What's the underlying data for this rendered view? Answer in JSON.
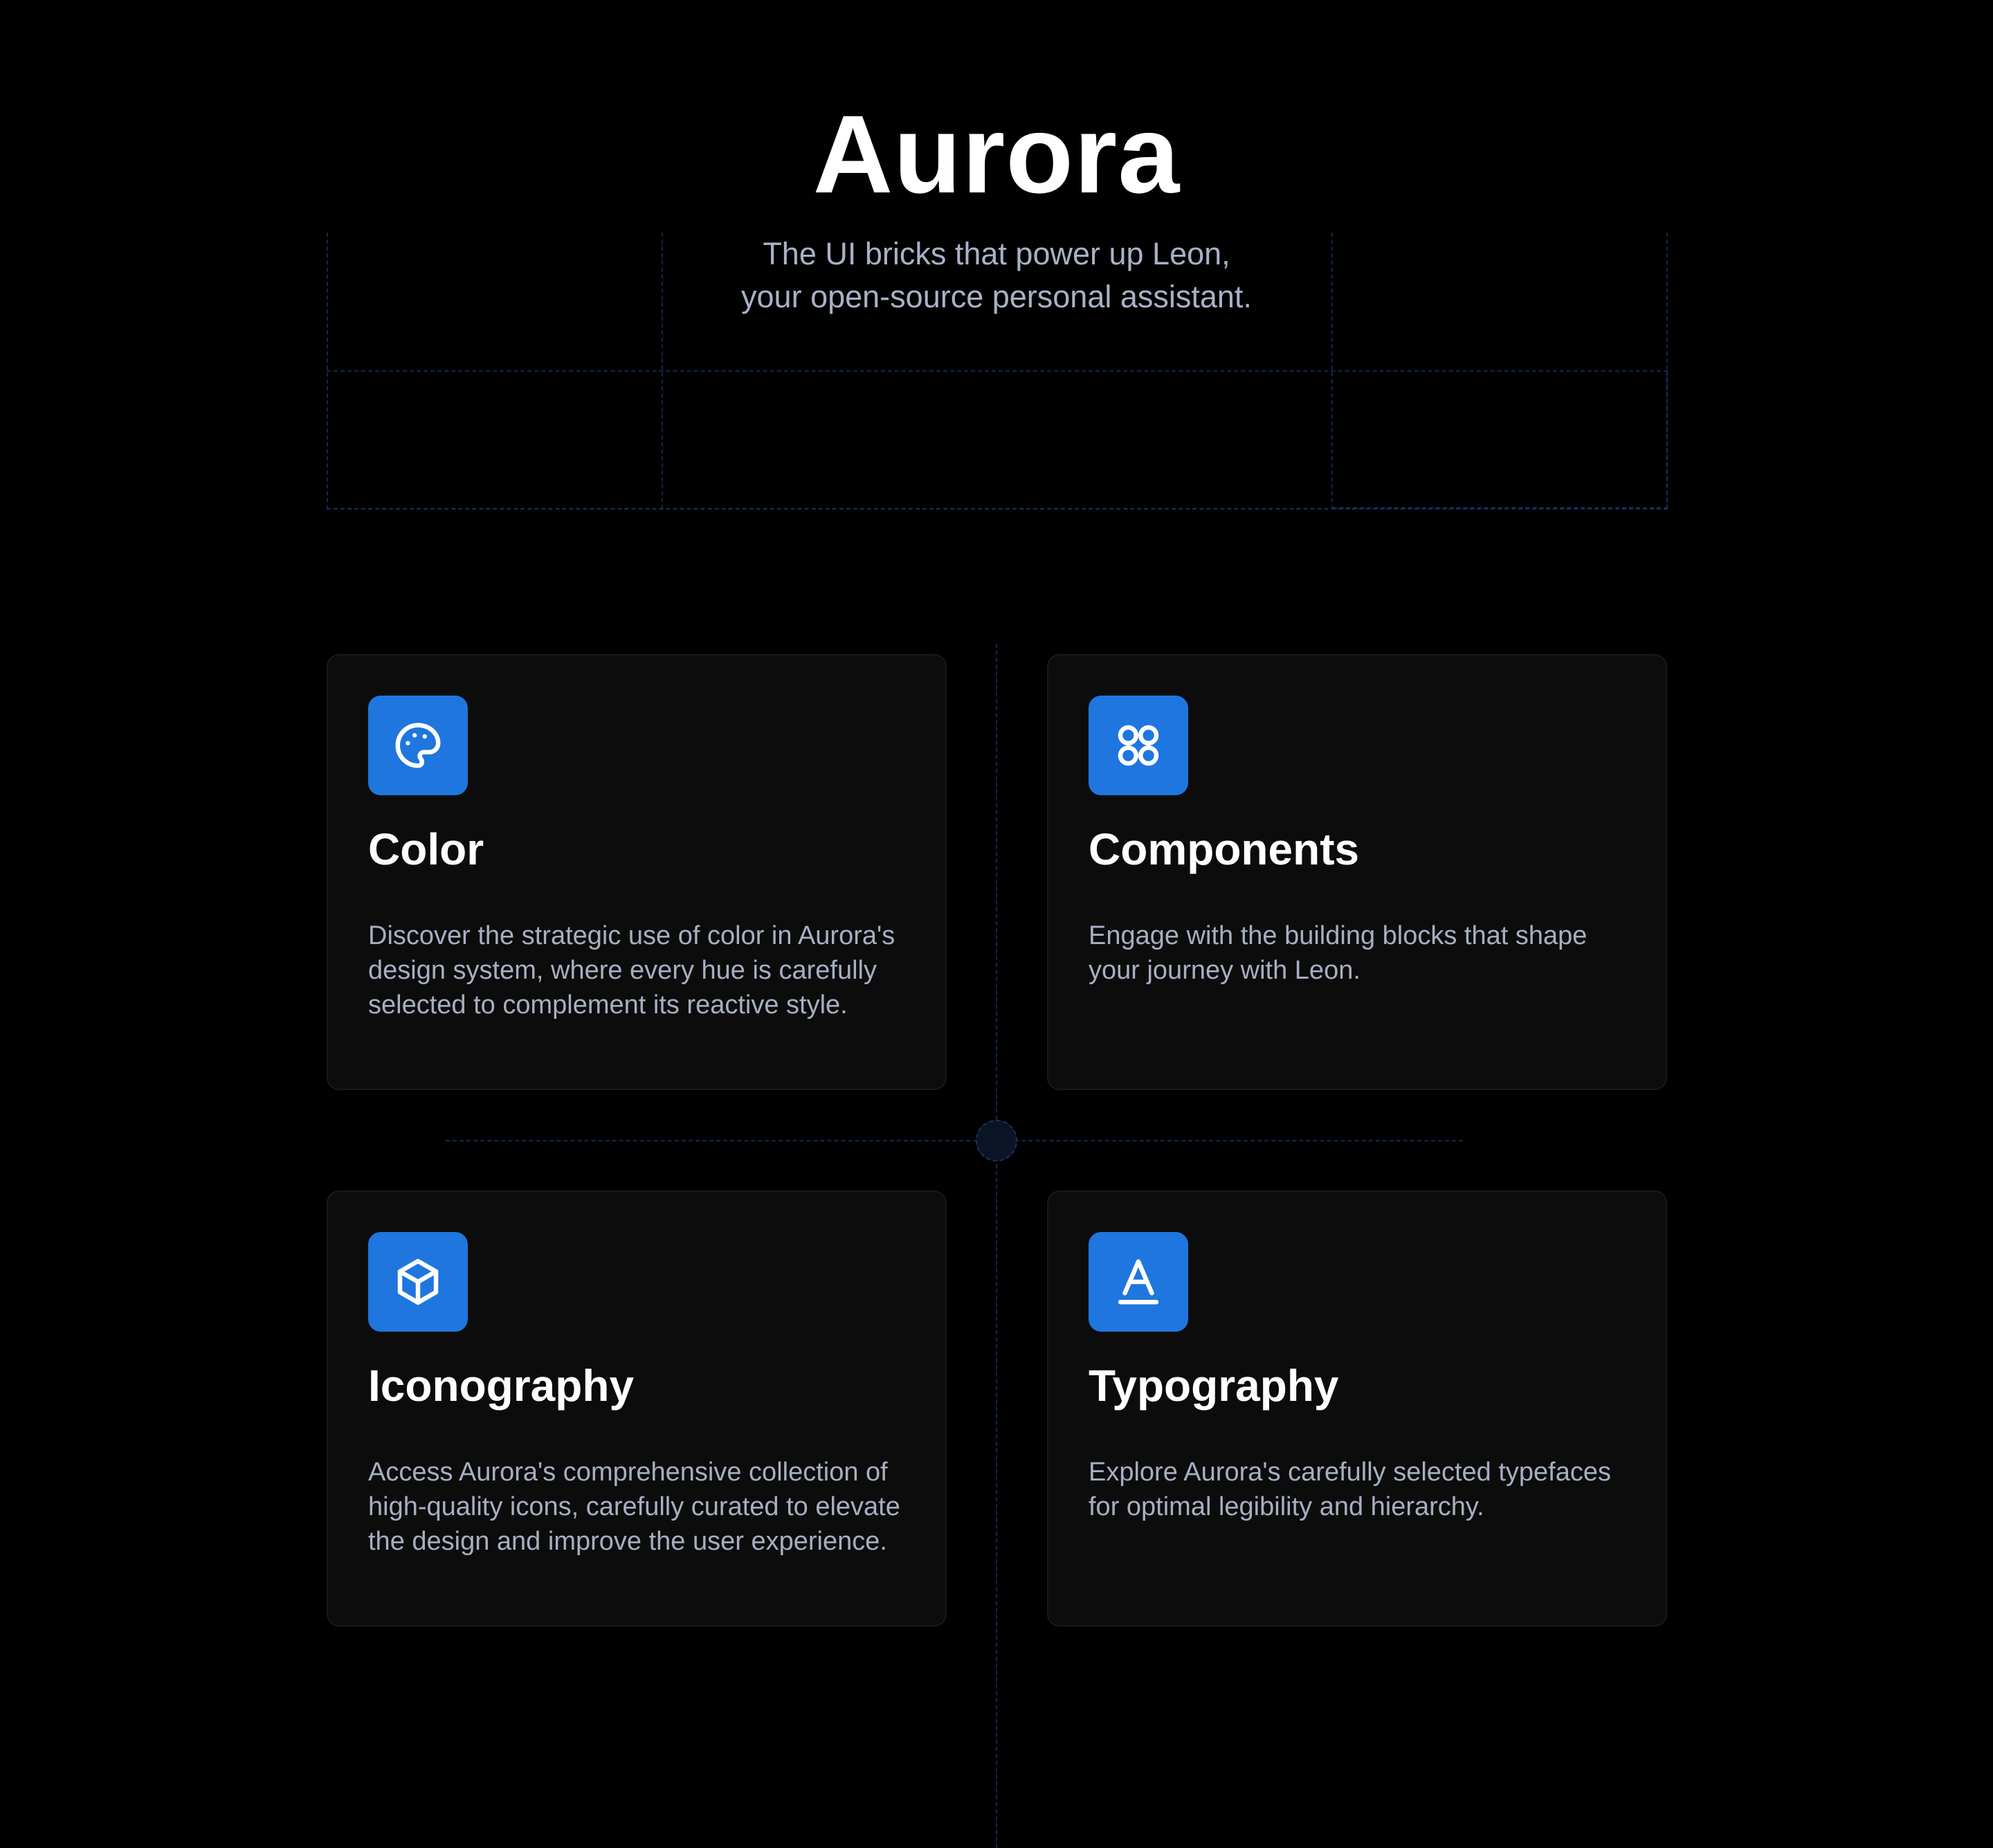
{
  "hero": {
    "title": "Aurora",
    "subtitle_lines": [
      "The UI bricks that power up Leon,",
      "your open-source personal assistant."
    ]
  },
  "theme": {
    "accent": "#1e76de",
    "background": "#000000",
    "card_background": "#0c0c0d",
    "text_muted": "#a7afc1"
  },
  "cards": [
    {
      "icon": "palette-icon",
      "title": "Color",
      "description_lines": [
        "Discover the strategic use of color in Aurora's",
        "design system, where every hue is carefully",
        "selected to complement its reactive style."
      ]
    },
    {
      "icon": "components-icon",
      "title": "Components",
      "description_lines": [
        "Engage with the building blocks that shape",
        "your journey with Leon."
      ]
    },
    {
      "icon": "cube-icon",
      "title": "Iconography",
      "description_lines": [
        "Access Aurora's comprehensive collection of",
        "high-quality icons, carefully curated to elevate",
        "the design and improve the user experience."
      ]
    },
    {
      "icon": "font-icon",
      "title": "Typography",
      "description_lines": [
        "Explore Aurora's carefully selected typefaces",
        "for optimal legibility and hierarchy."
      ]
    }
  ]
}
